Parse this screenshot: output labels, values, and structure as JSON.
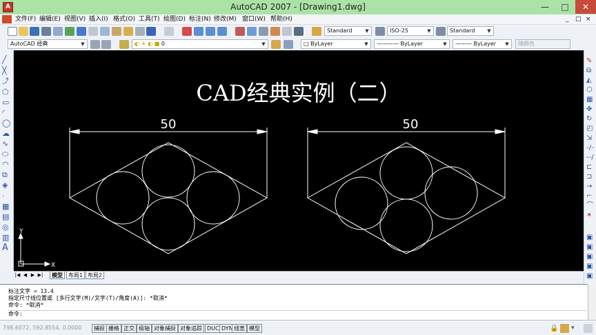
{
  "window": {
    "title": "AutoCAD 2007 - [Drawing1.dwg]",
    "app_icon": "autocad-logo-icon",
    "minimize": "—",
    "maximize": "□",
    "close": "✕"
  },
  "menubar": {
    "items": [
      "文件(F)",
      "编辑(E)",
      "视图(V)",
      "插入(I)",
      "格式(O)",
      "工具(T)",
      "绘图(D)",
      "标注(N)",
      "修改(M)",
      "窗口(W)",
      "帮助(H)"
    ],
    "window_controls": [
      "_",
      "□",
      "×"
    ]
  },
  "toolbar": {
    "text_style": "Standard",
    "dim_style": "ISO-25",
    "table_style": "Standard",
    "workspace": "AutoCAD 经典",
    "layer": "0",
    "color": "ByLayer",
    "linetype": "ByLayer",
    "lineweight": "ByLayer",
    "plot_style": "随颜色"
  },
  "canvas": {
    "title": "CAD经典实例（二）",
    "left_dimension": "50",
    "right_dimension": "50",
    "ucs_x": "X",
    "ucs_y": "Y",
    "colors": {
      "background": "#000000",
      "lines": "#ffffff"
    }
  },
  "layout_tabs": {
    "tabs": [
      "模型",
      "布局1",
      "布局2"
    ],
    "active": "模型"
  },
  "command_area": {
    "lines": [
      "标注文字 = 13.4",
      "指定尺寸线位置或 [多行文字(M)/文字(T)/角度(A)]: *取消*",
      "命令: *取消*",
      "命令:"
    ]
  },
  "statusbar": {
    "coords": "798.6072, 592.8554, 0.0000",
    "toggles": [
      "捕捉",
      "栅格",
      "正交",
      "极轴",
      "对象捕捉",
      "对象追踪",
      "DUCS",
      "DYN",
      "线宽",
      "模型"
    ]
  }
}
